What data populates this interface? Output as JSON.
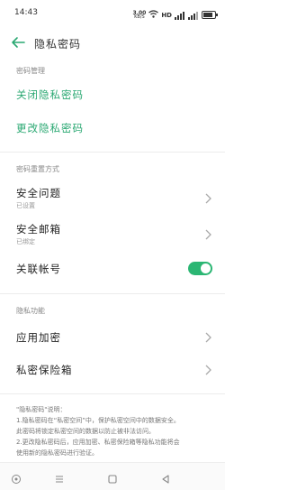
{
  "status_bar": {
    "time": "14:43",
    "speed_value": "3.00",
    "speed_unit": "KB/S",
    "network_label": "HD"
  },
  "header": {
    "title": "隐私密码"
  },
  "password_section": {
    "label": "密码管理",
    "turn_off": "关闭隐私密码",
    "change": "更改隐私密码"
  },
  "reset_section": {
    "label": "密码重置方式",
    "items": [
      {
        "title": "安全问题",
        "subtitle": "已设置"
      },
      {
        "title": "安全邮箱",
        "subtitle": "已绑定"
      }
    ],
    "toggle_label": "关联帐号",
    "toggle_state": "on"
  },
  "features_section": {
    "label": "隐私功能",
    "items": [
      {
        "title": "应用加密"
      },
      {
        "title": "私密保险箱"
      }
    ]
  },
  "note": {
    "title": "\"隐私密码\"说明：",
    "line1": "1.隐私密码在“私密空间”中，保护私密空间中的数据安全。",
    "line2": "此密码将锁定私密空间的数据以防止被非法访问。",
    "line3": "2.更改隐私密码后，应用加密、私密保险箱等隐私功能将会",
    "line4": "使用新的隐私密码进行验证。"
  },
  "colors": {
    "accent": "#2aa872",
    "toggle": "#2bb673"
  },
  "icons": {
    "back": "arrow-left-icon",
    "chevron": "chevron-right-icon",
    "nav_home": "circle-icon",
    "nav_menu": "menu-icon",
    "nav_recents": "square-icon",
    "nav_back": "triangle-left-icon"
  }
}
